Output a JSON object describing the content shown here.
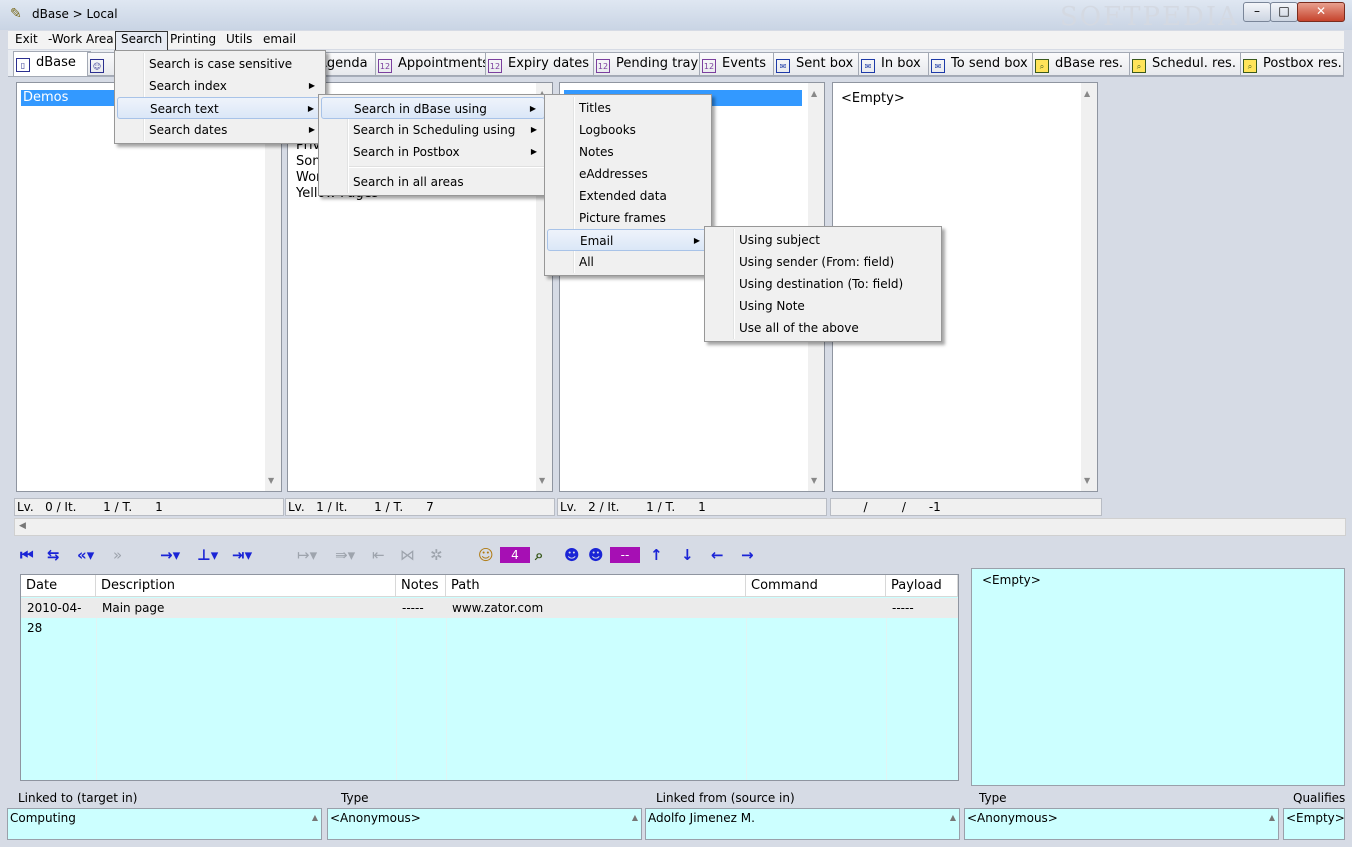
{
  "window": {
    "title": "dBase  > Local",
    "watermark": "SOFTPEDIA",
    "minimize": "–",
    "maximize": "□",
    "close": "✕"
  },
  "menubar": [
    "Exit",
    "-Work Area",
    "Search",
    "Printing",
    "Utils",
    "email"
  ],
  "tabs": [
    "dBase",
    "",
    "Agenda",
    "Appointments",
    "Expiry dates",
    "Pending tray",
    "Events",
    "Sent box",
    "In box",
    "To send box",
    "dBase res.",
    "Schedul. res.",
    "Postbox res."
  ],
  "panels": {
    "p1": {
      "selected": "Demos",
      "status": "Lv.   0 / It.       1 / T.      1"
    },
    "p2": {
      "items": [
        "Priv",
        "Son",
        "Wor",
        "Yellow Pages"
      ],
      "status": "Lv.   1 / It.       1 / T.      7"
    },
    "p3": {
      "status": "Lv.   2 / It.       1 / T.      1"
    },
    "p4": {
      "text": "<Empty>",
      "status": "        /         /      -1"
    }
  },
  "toolbar": {
    "counter": "4",
    "dash": "--"
  },
  "grid": {
    "columns": [
      "Date",
      "Description",
      "Notes",
      "Path",
      "Command",
      "Payload"
    ],
    "rows": [
      [
        "2010-04-28",
        "Main page",
        "-----",
        "www.zator.com",
        "",
        "-----"
      ]
    ]
  },
  "right_note": "<Empty>",
  "bottom": {
    "labels": [
      "Linked to (target in)",
      "Type",
      "Linked from (source in)",
      "Type",
      "Qualifies"
    ],
    "values": [
      "Computing",
      "<Anonymous>",
      "Adolfo Jimenez M.",
      "<Anonymous>",
      "<Empty>"
    ]
  },
  "menus": {
    "search": [
      "Search is case sensitive",
      "Search index",
      "Search text",
      "Search dates"
    ],
    "search_text": [
      "Search in dBase using",
      "Search in Scheduling using",
      "Search in Postbox",
      "Search in all areas"
    ],
    "dbase_using": [
      "Titles",
      "Logbooks",
      "Notes",
      "eAddresses",
      "Extended data",
      "Picture frames",
      "Email",
      "All"
    ],
    "email": [
      "Using subject",
      "Using sender (From: field)",
      "Using destination (To: field)",
      "Using Note",
      "Use all of the above"
    ]
  },
  "colors": {
    "accent_purple": "#a60fb4",
    "grid_bg": "#ccffff",
    "selection": "#3399ff"
  }
}
